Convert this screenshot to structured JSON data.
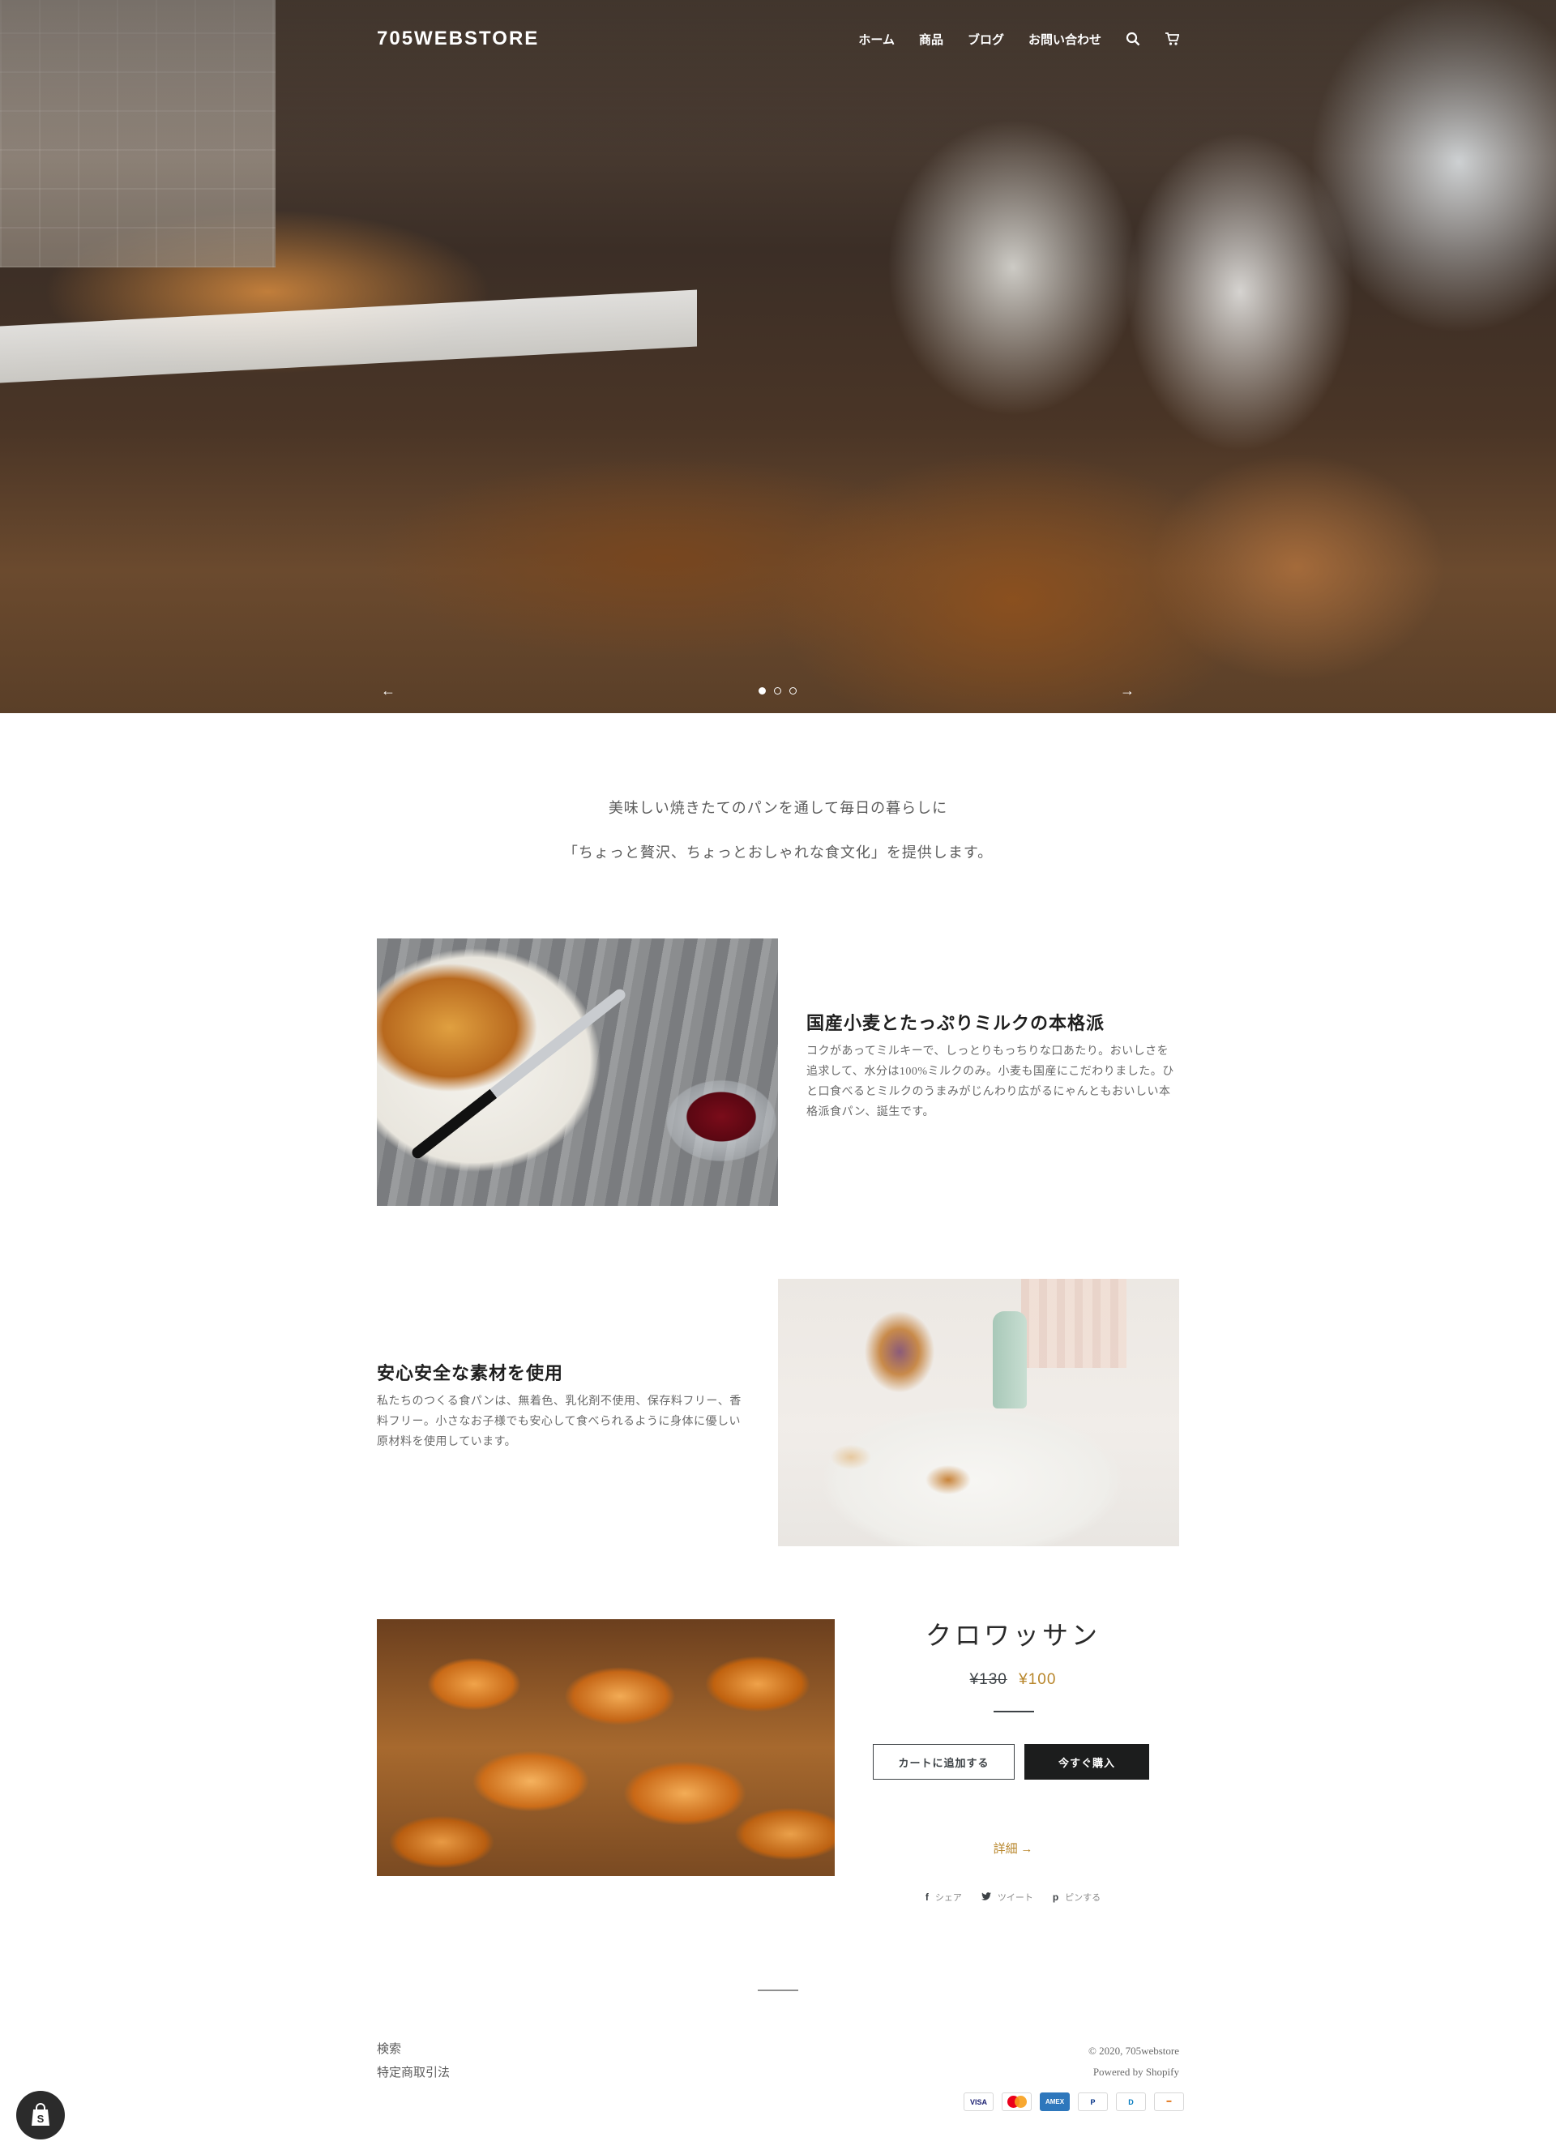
{
  "header": {
    "logo": "705WEBSTORE",
    "nav": [
      "ホーム",
      "商品",
      "ブログ",
      "お問い合わせ"
    ],
    "icons": [
      "search-icon",
      "cart-icon"
    ]
  },
  "hero": {
    "prev": "←",
    "next": "→",
    "slide_count": 3,
    "active_slide": 1
  },
  "intro": {
    "line1": "美味しい焼きたてのパンを通して毎日の暮らしに",
    "line2": "「ちょっと贅沢、ちょっとおしゃれな食文化」を提供します。"
  },
  "features": [
    {
      "title": "国産小麦とたっぷりミルクの本格派",
      "text": "コクがあってミルキーで、しっとりもっちりな口あたり。おいしさを追求して、水分は100%ミルクのみ。小麦も国産にこだわりました。ひと口食べるとミルクのうまみがじんわり広がるにゃんともおいしい本格派食パン、誕生です。"
    },
    {
      "title": "安心安全な素材を使用",
      "text": "私たちのつくる食パンは、無着色、乳化剤不使用、保存料フリー、香料フリー。小さなお子様でも安心して食べられるように身体に優しい原材料を使用しています。"
    }
  ],
  "product": {
    "title": "クロワッサン",
    "price_old": "¥130",
    "price_sale": "¥100",
    "add_to_cart": "カートに追加する",
    "buy_now": "今すぐ購入",
    "details": "詳細 →",
    "share": [
      "シェア",
      "ツイート",
      "ピンする"
    ]
  },
  "footer": {
    "links": [
      "検索",
      "特定商取引法"
    ],
    "copyright": "© 2020, 705webstore",
    "powered": "Powered by Shopify",
    "payments": [
      "VISA",
      "Mastercard",
      "AMEX",
      "P",
      "D",
      "DISCOVER"
    ]
  },
  "colors": {
    "accent": "#b8862b",
    "text": "#3d4246",
    "button_dark": "#1c1d1d"
  }
}
